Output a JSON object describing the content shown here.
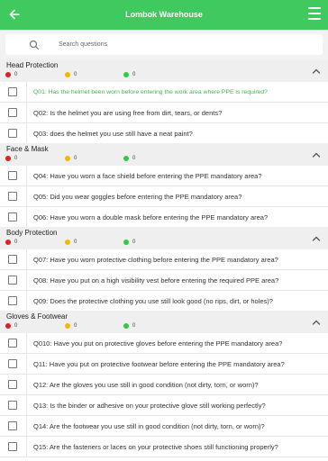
{
  "header": {
    "title": "Lombok Warehouse",
    "back_icon": "back-arrow-icon",
    "menu_icon": "list-icon"
  },
  "search": {
    "placeholder": "Search questions",
    "icon": "search-icon"
  },
  "colors": {
    "brand": "#3fc95f",
    "red": "#e02020",
    "yellow": "#f5b800",
    "green": "#2ecc40"
  },
  "sections": [
    {
      "name": "Head Protection",
      "counts": {
        "red": "0",
        "yellow": "0",
        "green": "0"
      },
      "questions": [
        "Q01: Has the helmet been worn before entering the work area where PPE is required?",
        "Q02: Is the helmet you are using free from dirt, tears, or dents?",
        "Q03: does the helmet you use still have a neat paint?"
      ]
    },
    {
      "name": "Face & Mask",
      "counts": {
        "red": "0",
        "yellow": "0",
        "green": "0"
      },
      "questions": [
        "Q04: Have you worn a face shield before entering the PPE mandatory area?",
        "Q05: Did you wear goggles before entering the PPE mandatory area?",
        "Q06: Have you worn a double mask before entering the PPE mandatory area?"
      ]
    },
    {
      "name": "Body Protection",
      "counts": {
        "red": "0",
        "yellow": "0",
        "green": "0"
      },
      "questions": [
        "Q07: Have you worn protective clothing before entering the PPE mandatory area?",
        "Q08: Have you put on a high visibility vest before entering the required PPE area?",
        "Q09: Does the protective clothing you use still look good (no rips, dirt, or holes)?"
      ]
    },
    {
      "name": "Gloves & Footwear",
      "counts": {
        "red": "0",
        "yellow": "0",
        "green": "0"
      },
      "questions": [
        "Q010: Have you put on protective gloves before entering the PPE mandatory area?",
        "Q11: Have you put on protective footwear before entering the PPE mandatory area?",
        "Q12: Are the gloves you use still in good condition (not dirty, torn, or worn)?",
        "Q13: Is the binder or adhesive on your protective glove still working perfectly?",
        "Q14: Are the footwear you use still in good condition (not dirty, torn, or worn)?",
        "Q15: Are the fasteners or laces on your protective shoes still functioning properly?"
      ]
    }
  ]
}
